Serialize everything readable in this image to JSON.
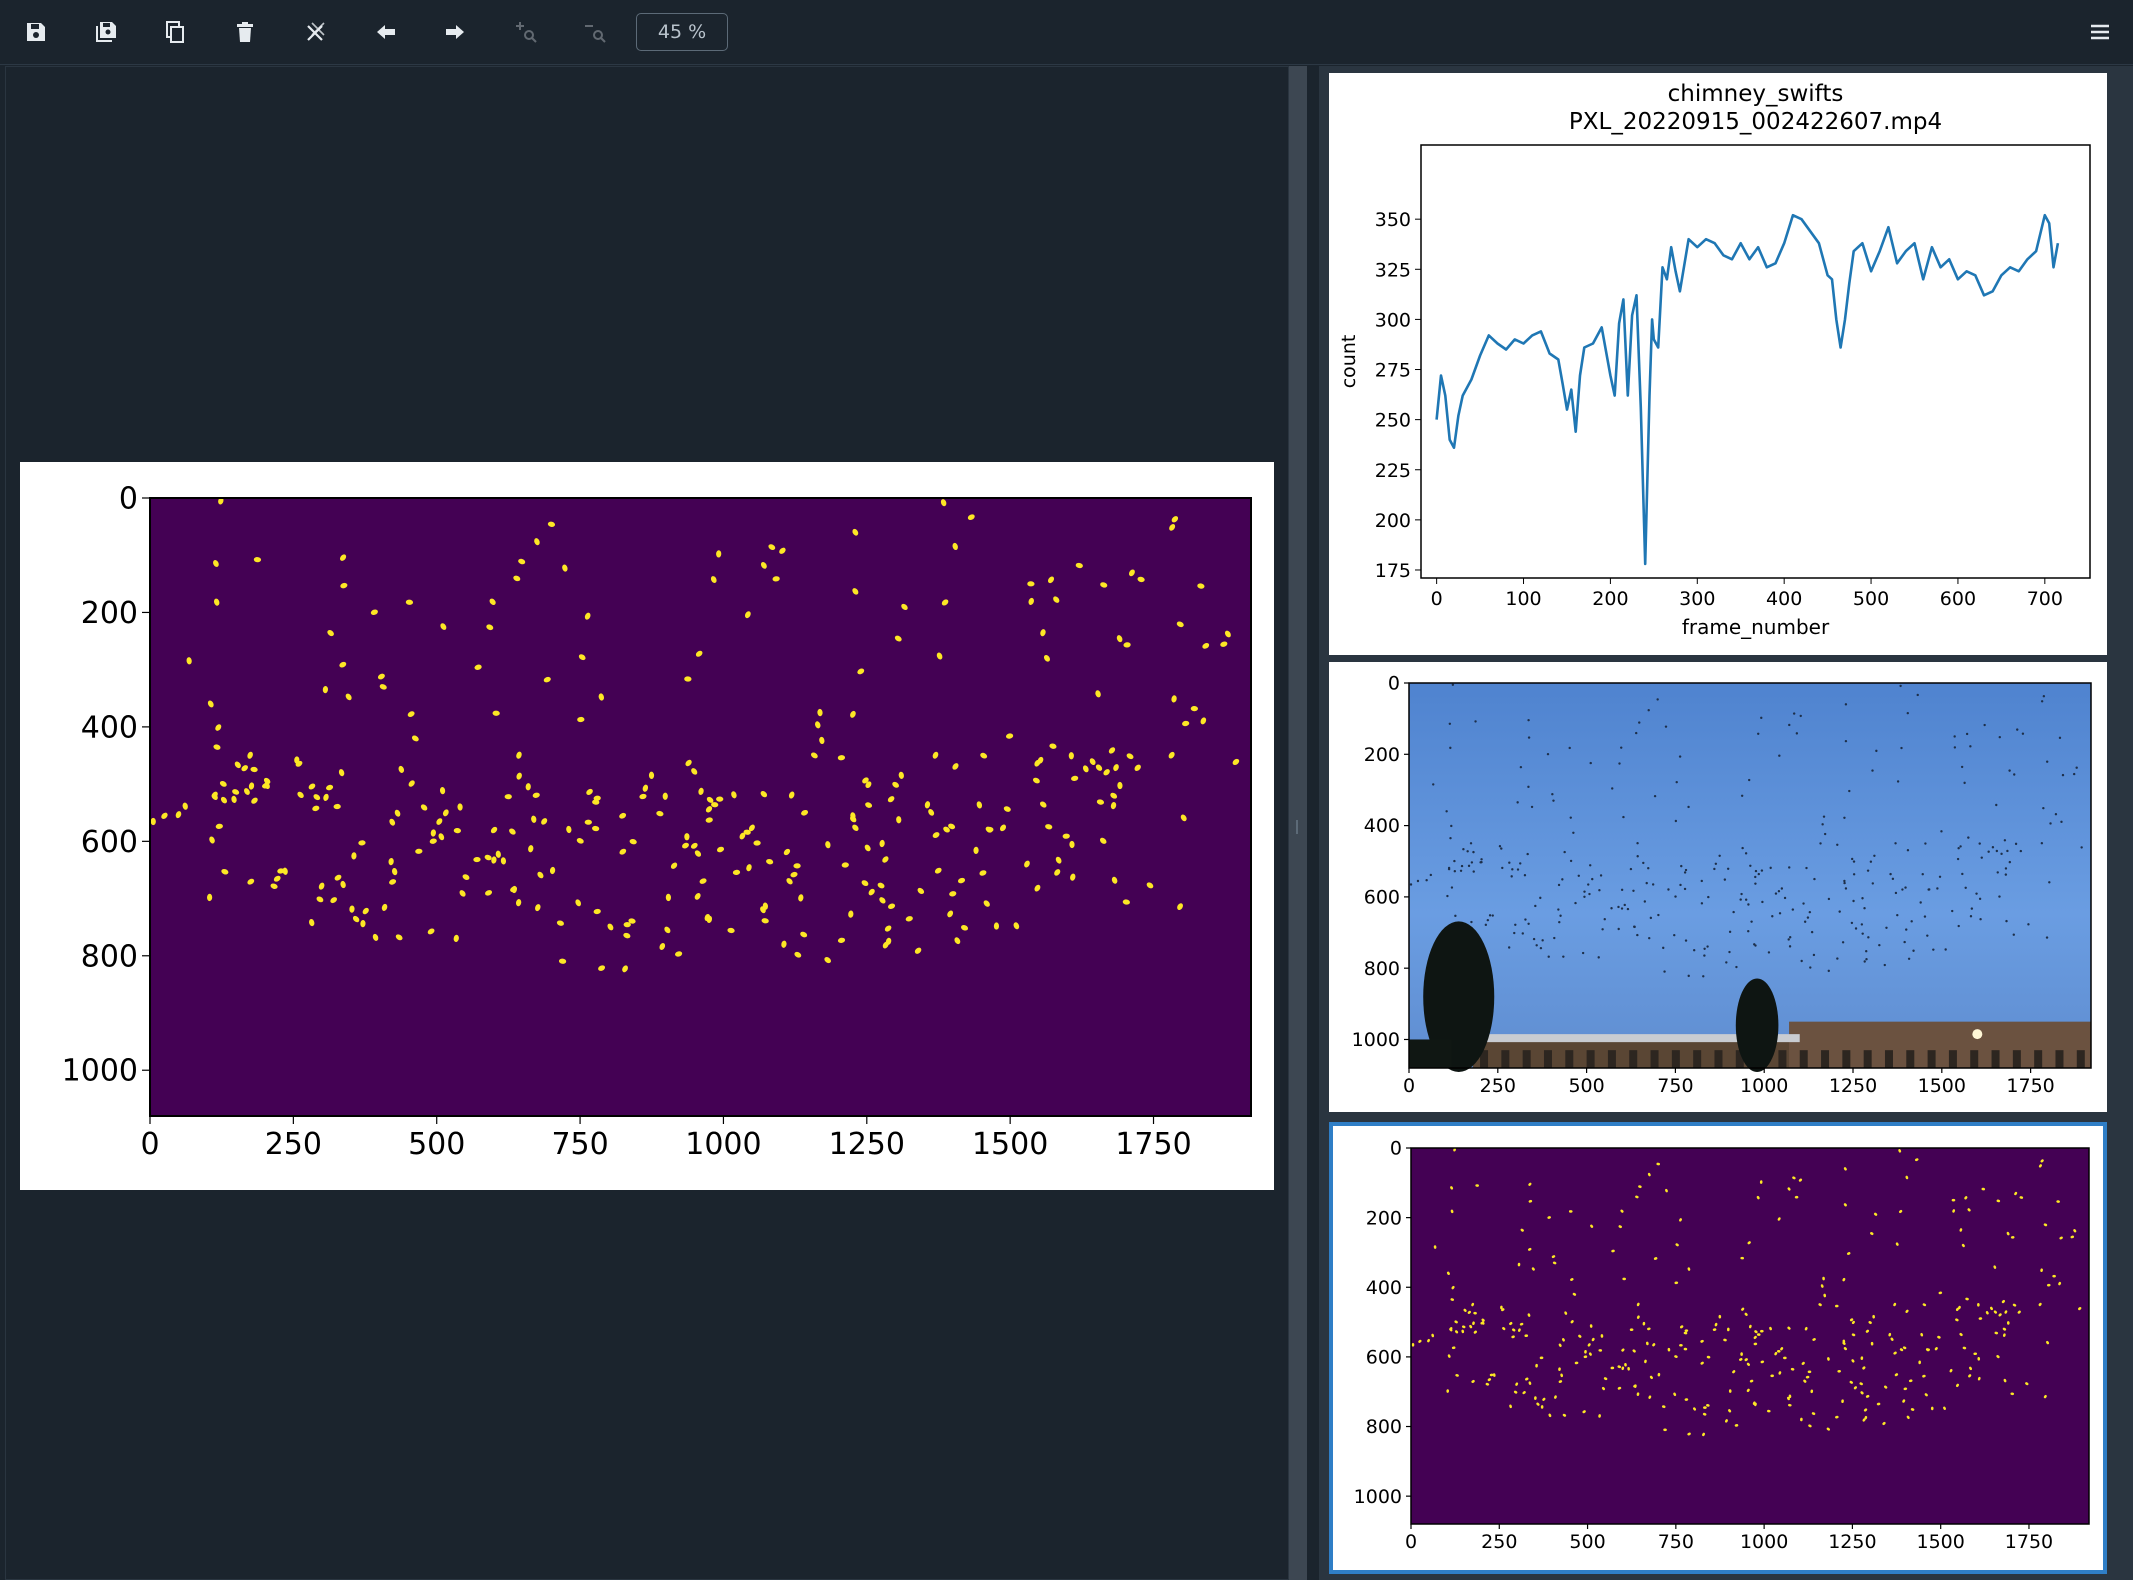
{
  "toolbar": {
    "buttons": [
      {
        "name": "save-icon",
        "enabled": true
      },
      {
        "name": "save-all-icon",
        "enabled": true
      },
      {
        "name": "copy-icon",
        "enabled": true
      },
      {
        "name": "trash-icon",
        "enabled": true
      },
      {
        "name": "close-all-icon",
        "enabled": true
      },
      {
        "name": "arrow-left-icon",
        "enabled": true
      },
      {
        "name": "arrow-right-icon",
        "enabled": true
      },
      {
        "name": "zoom-in-icon",
        "enabled": false
      },
      {
        "name": "zoom-out-icon",
        "enabled": false
      }
    ],
    "zoom_label": "45 %",
    "menu_icon": "hamburger-icon"
  },
  "colors": {
    "background": "#1b242d",
    "panel": "#2a3540",
    "selected_border": "#2f7ec6",
    "viridis_dark": "#440154",
    "viridis_yellow": "#fde725",
    "line_blue": "#1f77b4",
    "sky": "#5b8fd6"
  },
  "chart_data": [
    {
      "type": "line",
      "title": "chimney_swifts\nPXL_20220915_002422607.mp4",
      "title_lines": [
        "chimney_swifts",
        "PXL_20220915_002422607.mp4"
      ],
      "xlabel": "frame_number",
      "ylabel": "count",
      "xlim": [
        -18,
        752
      ],
      "ylim": [
        171,
        187
      ],
      "ylim_full": [
        171,
        387
      ],
      "xticks": [
        0,
        100,
        200,
        300,
        400,
        500,
        600,
        700
      ],
      "yticks": [
        175,
        200,
        225,
        250,
        275,
        300,
        325,
        350
      ],
      "series": [
        {
          "x": [
            0,
            5,
            10,
            15,
            20,
            25,
            30,
            40,
            50,
            60,
            70,
            80,
            90,
            100,
            110,
            120,
            130,
            140,
            145,
            150,
            155,
            160,
            165,
            170,
            180,
            190,
            200,
            205,
            210,
            215,
            220,
            225,
            230,
            235,
            240,
            245,
            248,
            250,
            255,
            260,
            265,
            270,
            275,
            280,
            290,
            300,
            310,
            320,
            330,
            340,
            350,
            360,
            370,
            380,
            390,
            400,
            410,
            420,
            430,
            440,
            450,
            455,
            460,
            465,
            470,
            475,
            480,
            490,
            500,
            510,
            520,
            530,
            540,
            550,
            560,
            570,
            580,
            590,
            600,
            610,
            620,
            630,
            640,
            650,
            660,
            670,
            680,
            690,
            700,
            705,
            710,
            715
          ],
          "y": [
            250,
            272,
            262,
            240,
            236,
            252,
            262,
            270,
            282,
            292,
            288,
            285,
            290,
            288,
            292,
            294,
            283,
            280,
            268,
            255,
            265,
            244,
            272,
            286,
            288,
            296,
            272,
            262,
            298,
            310,
            262,
            302,
            312,
            256,
            178,
            262,
            300,
            290,
            286,
            326,
            320,
            336,
            324,
            314,
            340,
            336,
            340,
            338,
            332,
            330,
            338,
            330,
            336,
            326,
            328,
            338,
            352,
            350,
            344,
            338,
            322,
            320,
            300,
            286,
            300,
            318,
            334,
            338,
            324,
            334,
            346,
            328,
            334,
            338,
            320,
            336,
            326,
            330,
            320,
            324,
            322,
            312,
            314,
            322,
            326,
            324,
            330,
            334,
            352,
            348,
            326,
            338
          ]
        }
      ]
    },
    {
      "type": "image",
      "name": "video-frame",
      "xlim": [
        0,
        1920
      ],
      "ylim": [
        1080,
        0
      ],
      "xticks": [
        0,
        250,
        500,
        750,
        1000,
        1250,
        1500,
        1750
      ],
      "yticks": [
        0,
        200,
        400,
        600,
        800,
        1000
      ]
    },
    {
      "type": "image",
      "name": "detection-mask",
      "xlim": [
        0,
        1920
      ],
      "ylim": [
        1080,
        0
      ],
      "xticks": [
        0,
        250,
        500,
        750,
        1000,
        1250,
        1500,
        1750
      ],
      "yticks": [
        0,
        200,
        400,
        600,
        800,
        1000
      ]
    }
  ]
}
